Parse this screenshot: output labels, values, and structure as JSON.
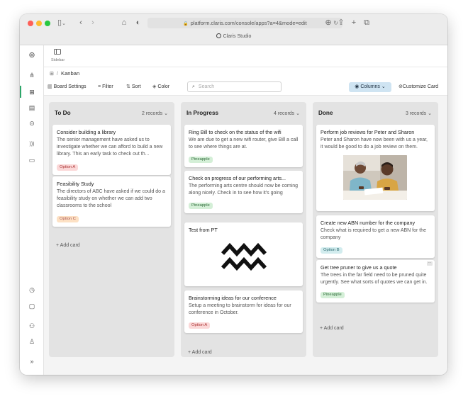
{
  "browser": {
    "url": "platform.claris.com/console/apps?a=4&mode=edit",
    "tab_title": "Claris Studio"
  },
  "sidebar": {
    "toggle_label": "Sidebar"
  },
  "breadcrumb": {
    "current": "Kanban"
  },
  "toolbar": {
    "board_settings": "Board Settings",
    "filter": "Filter",
    "sort": "Sort",
    "color": "Color",
    "search_placeholder": "Search",
    "columns": "Columns",
    "customize_card": "Customize Card"
  },
  "board": {
    "add_card_label": "+ Add card",
    "columns": [
      {
        "title": "To Do",
        "count": "2 records",
        "cards": [
          {
            "title": "Consider building a library",
            "desc": "The senior management have asked us to investigate whether we can afford to build a new library. This an early task to check out th...",
            "tag": "Option A"
          },
          {
            "title": "Feasibility Study",
            "desc": "The directors of ABC have asked if we could do a feasibility study on whether we can add two classrooms to the school",
            "tag": "Option C"
          }
        ]
      },
      {
        "title": "In Progress",
        "count": "4 records",
        "cards": [
          {
            "title": "Ring Bill to check on the status of the wifi",
            "desc": "We are due to get a new wifi router, give Bill a call to see where things are at.",
            "tag": "Pineapple"
          },
          {
            "title": "Check on progress of our performing arts...",
            "desc": "The performing arts centre should now be coming along nicely. Check in to see how it's going",
            "tag": "Pineapple"
          },
          {
            "title": "Test from PT",
            "desc": "",
            "tag": ""
          },
          {
            "title": "Brainstorming ideas for our conference",
            "desc": "Setup a meeting to brainstorm for ideas for our conference in October.",
            "tag": "Option A"
          }
        ]
      },
      {
        "title": "Done",
        "count": "3 records",
        "cards": [
          {
            "title": "Perform job reviews for Peter and Sharon",
            "desc": "Peter and Sharon have now been with us a year, it would be good to do a job review on them.",
            "tag": ""
          },
          {
            "title": "Create new ABN number for the company",
            "desc": "Check what is required to get a new ABN for the company",
            "tag": "Option B"
          },
          {
            "title": "Get tree pruner to give us a quote",
            "desc": "The trees in the far field need to be pruned quite urgently. See what sorts of quotes we can get in.",
            "tag": "Pineapple"
          }
        ]
      }
    ]
  },
  "colors": {
    "accent_green": "#2ea66a",
    "columns_button_bg": "#cfe4f2",
    "tag_red": "#fbd8d8",
    "tag_orange": "#fde1c4",
    "tag_green": "#d4efd7",
    "tag_teal": "#d2ecee"
  },
  "icons": [
    "claris-logo-icon",
    "share-nodes-icon",
    "grid-icon",
    "id-card-icon",
    "dollar-circle-icon",
    "rss-icon",
    "browser-window-icon",
    "clock-icon",
    "chat-icon",
    "users-icon",
    "user-icon",
    "expand-icon",
    "search-icon",
    "eye-icon",
    "chevron-down-icon",
    "aquarius-icon"
  ]
}
